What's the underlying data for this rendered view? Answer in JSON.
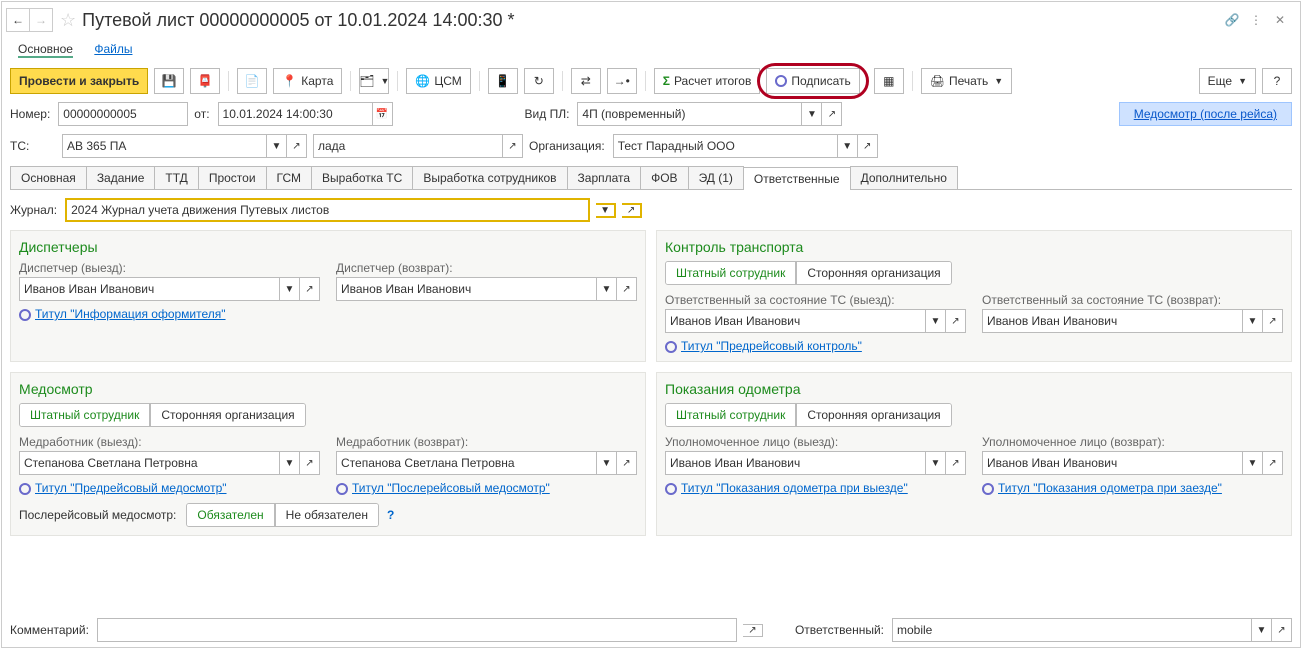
{
  "title": "Путевой лист 00000000005 от 10.01.2024 14:00:30 *",
  "subnav": {
    "main": "Основное",
    "files": "Файлы"
  },
  "toolbar": {
    "post_close": "Провести и закрыть",
    "map": "Карта",
    "csm": "ЦСМ",
    "calc": "Расчет итогов",
    "sign": "Подписать",
    "print": "Печать",
    "more": "Еще"
  },
  "top": {
    "number_label": "Номер:",
    "number": "00000000005",
    "from_label": "от:",
    "from": "10.01.2024 14:00:30",
    "vidpl_label": "Вид ПЛ:",
    "vidpl": "4П (повременный)",
    "med_banner": "Медосмотр (после рейса)",
    "ts_label": "ТС:",
    "ts": "АВ 365 ПА",
    "model": "лада",
    "org_label": "Организация:",
    "org": "Тест Парадный ООО"
  },
  "tabs": [
    "Основная",
    "Задание",
    "ТТД",
    "Простои",
    "ГСМ",
    "Выработка ТС",
    "Выработка сотрудников",
    "Зарплата",
    "ФОВ",
    "ЭД (1)",
    "Ответственные",
    "Дополнительно"
  ],
  "active_tab": 10,
  "journal": {
    "label": "Журнал:",
    "value": "2024 Журнал учета движения Путевых листов"
  },
  "disp": {
    "title": "Диспетчеры",
    "out_label": "Диспетчер (выезд):",
    "out": "Иванов Иван Иванович",
    "in_label": "Диспетчер (возврат):",
    "in": "Иванов Иван Иванович",
    "titul": "Титул \"Информация оформителя\""
  },
  "kontrol": {
    "title": "Контроль транспорта",
    "seg_staff": "Штатный сотрудник",
    "seg_ext": "Сторонняя организация",
    "out_label": "Ответственный за состояние ТС (выезд):",
    "out": "Иванов Иван Иванович",
    "in_label": "Ответственный за состояние ТС (возврат):",
    "in": "Иванов Иван Иванович",
    "titul": "Титул \"Предрейсовый контроль\""
  },
  "med": {
    "title": "Медосмотр",
    "seg_staff": "Штатный сотрудник",
    "seg_ext": "Сторонняя организация",
    "out_label": "Медработник (выезд):",
    "out": "Степанова Светлана Петровна",
    "in_label": "Медработник (возврат):",
    "in": "Степанова Светлана Петровна",
    "titul_out": "Титул \"Предрейсовый медосмотр\"",
    "titul_in": "Титул \"Послерейсовый медосмотр\"",
    "post_label": "Послерейсовый медосмотр:",
    "post_req": "Обязателен",
    "post_opt": "Не обязателен"
  },
  "odo": {
    "title": "Показания одометра",
    "seg_staff": "Штатный сотрудник",
    "seg_ext": "Сторонняя организация",
    "out_label": "Уполномоченное лицо (выезд):",
    "out": "Иванов Иван Иванович",
    "in_label": "Уполномоченное лицо (возврат):",
    "in": "Иванов Иван Иванович",
    "titul_out": "Титул \"Показания одометра при выезде\"",
    "titul_in": "Титул \"Показания одометра при заезде\""
  },
  "footer": {
    "comment_label": "Комментарий:",
    "comment": "",
    "resp_label": "Ответственный:",
    "resp": "mobile"
  }
}
